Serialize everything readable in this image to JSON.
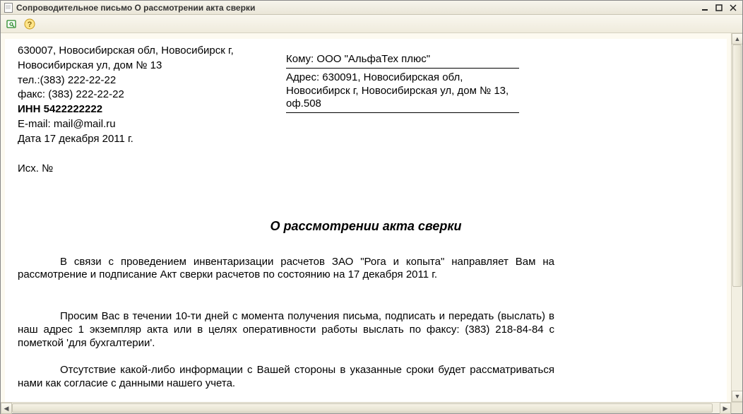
{
  "window": {
    "title": "Сопроводительное письмо О рассмотрении акта сверки"
  },
  "sender": {
    "address_line1": "630007, Новосибирская обл, Новосибирск г,",
    "address_line2": "Новосибирская ул, дом № 13",
    "tel": "тел.:(383) 222-22-22",
    "fax": "факс: (383) 222-22-22",
    "inn": "ИНН 5422222222",
    "email": "E-mail: mail@mail.ru",
    "date": "Дата  17 декабря 2011 г."
  },
  "recipient": {
    "to_label": "Кому:",
    "to_value": "ООО \"АльфаТех плюс\"",
    "addr_label": "Адрес:",
    "addr_value": "630091, Новосибирская обл, Новосибирск г, Новосибирская ул, дом № 13, оф.508"
  },
  "outgoing_label": "Исх. №",
  "document_title": "О рассмотрении акта сверки",
  "paragraph1": "В связи с проведением инвентаризации расчетов ЗАО \"Рога и копыта\" направляет Вам на рассмотрение и подписание Акт сверки расчетов  по состоянию на 17 декабря 2011 г.",
  "paragraph2": "Просим Вас в течении 10-ти дней с момента получения письма, подписать и передать (выслать) в наш адрес 1 экземпляр акта или в целях оперативности работы выслать по факсу: (383) 218-84-84 с пометкой 'для бухгалтерии'.",
  "paragraph3": "Отсутствие какой-либо информации с Вашей стороны в указанные сроки будет рассматриваться нами как согласие с данными нашего учета."
}
